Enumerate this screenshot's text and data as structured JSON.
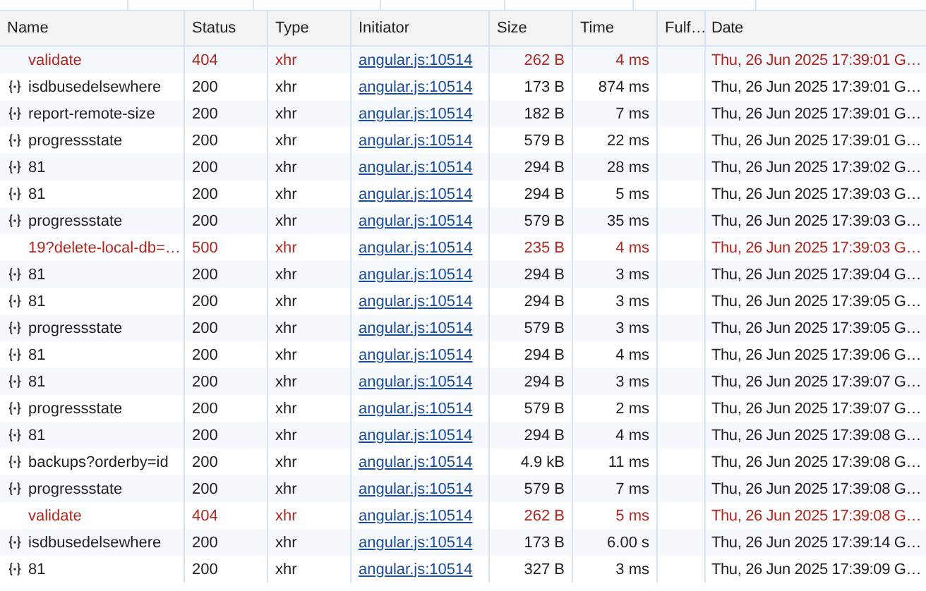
{
  "columns": [
    "Name",
    "Status",
    "Type",
    "Initiator",
    "Size",
    "Time",
    "Fulf…",
    "Date"
  ],
  "rows": [
    {
      "kind": "failed",
      "name": "validate",
      "status": "404",
      "type": "xhr",
      "initiator": "angular.js:10514",
      "size": "262 B",
      "time": "4 ms",
      "date": "Thu, 26 Jun 2025 17:39:01 G…"
    },
    {
      "kind": "json",
      "name": "isdbusedelsewhere",
      "status": "200",
      "type": "xhr",
      "initiator": "angular.js:10514",
      "size": "173 B",
      "time": "874 ms",
      "date": "Thu, 26 Jun 2025 17:39:01 G…"
    },
    {
      "kind": "json",
      "name": "report-remote-size",
      "status": "200",
      "type": "xhr",
      "initiator": "angular.js:10514",
      "size": "182 B",
      "time": "7 ms",
      "date": "Thu, 26 Jun 2025 17:39:01 G…"
    },
    {
      "kind": "json",
      "name": "progressstate",
      "status": "200",
      "type": "xhr",
      "initiator": "angular.js:10514",
      "size": "579 B",
      "time": "22 ms",
      "date": "Thu, 26 Jun 2025 17:39:01 G…"
    },
    {
      "kind": "json",
      "name": "81",
      "status": "200",
      "type": "xhr",
      "initiator": "angular.js:10514",
      "size": "294 B",
      "time": "28 ms",
      "date": "Thu, 26 Jun 2025 17:39:02 G…"
    },
    {
      "kind": "json",
      "name": "81",
      "status": "200",
      "type": "xhr",
      "initiator": "angular.js:10514",
      "size": "294 B",
      "time": "5 ms",
      "date": "Thu, 26 Jun 2025 17:39:03 G…"
    },
    {
      "kind": "json",
      "name": "progressstate",
      "status": "200",
      "type": "xhr",
      "initiator": "angular.js:10514",
      "size": "579 B",
      "time": "35 ms",
      "date": "Thu, 26 Jun 2025 17:39:03 G…"
    },
    {
      "kind": "failed",
      "name": "19?delete-local-db=…",
      "status": "500",
      "type": "xhr",
      "initiator": "angular.js:10514",
      "size": "235 B",
      "time": "4 ms",
      "date": "Thu, 26 Jun 2025 17:39:03 G…"
    },
    {
      "kind": "json",
      "name": "81",
      "status": "200",
      "type": "xhr",
      "initiator": "angular.js:10514",
      "size": "294 B",
      "time": "3 ms",
      "date": "Thu, 26 Jun 2025 17:39:04 G…"
    },
    {
      "kind": "json",
      "name": "81",
      "status": "200",
      "type": "xhr",
      "initiator": "angular.js:10514",
      "size": "294 B",
      "time": "3 ms",
      "date": "Thu, 26 Jun 2025 17:39:05 G…"
    },
    {
      "kind": "json",
      "name": "progressstate",
      "status": "200",
      "type": "xhr",
      "initiator": "angular.js:10514",
      "size": "579 B",
      "time": "3 ms",
      "date": "Thu, 26 Jun 2025 17:39:05 G…"
    },
    {
      "kind": "json",
      "name": "81",
      "status": "200",
      "type": "xhr",
      "initiator": "angular.js:10514",
      "size": "294 B",
      "time": "4 ms",
      "date": "Thu, 26 Jun 2025 17:39:06 G…"
    },
    {
      "kind": "json",
      "name": "81",
      "status": "200",
      "type": "xhr",
      "initiator": "angular.js:10514",
      "size": "294 B",
      "time": "3 ms",
      "date": "Thu, 26 Jun 2025 17:39:07 G…"
    },
    {
      "kind": "json",
      "name": "progressstate",
      "status": "200",
      "type": "xhr",
      "initiator": "angular.js:10514",
      "size": "579 B",
      "time": "2 ms",
      "date": "Thu, 26 Jun 2025 17:39:07 G…"
    },
    {
      "kind": "json",
      "name": "81",
      "status": "200",
      "type": "xhr",
      "initiator": "angular.js:10514",
      "size": "294 B",
      "time": "4 ms",
      "date": "Thu, 26 Jun 2025 17:39:08 G…"
    },
    {
      "kind": "json",
      "name": "backups?orderby=id",
      "status": "200",
      "type": "xhr",
      "initiator": "angular.js:10514",
      "size": "4.9 kB",
      "time": "11 ms",
      "date": "Thu, 26 Jun 2025 17:39:08 G…"
    },
    {
      "kind": "json",
      "name": "progressstate",
      "status": "200",
      "type": "xhr",
      "initiator": "angular.js:10514",
      "size": "579 B",
      "time": "7 ms",
      "date": "Thu, 26 Jun 2025 17:39:08 G…"
    },
    {
      "kind": "failed",
      "name": "validate",
      "status": "404",
      "type": "xhr",
      "initiator": "angular.js:10514",
      "size": "262 B",
      "time": "5 ms",
      "date": "Thu, 26 Jun 2025 17:39:08 G…"
    },
    {
      "kind": "json",
      "name": "isdbusedelsewhere",
      "status": "200",
      "type": "xhr",
      "initiator": "angular.js:10514",
      "size": "173 B",
      "time": "6.00 s",
      "date": "Thu, 26 Jun 2025 17:39:14 G…"
    },
    {
      "kind": "json",
      "name": "81",
      "status": "200",
      "type": "xhr",
      "initiator": "angular.js:10514",
      "size": "327 B",
      "time": "3 ms",
      "date": "Thu, 26 Jun 2025 17:39:09 G…"
    }
  ]
}
